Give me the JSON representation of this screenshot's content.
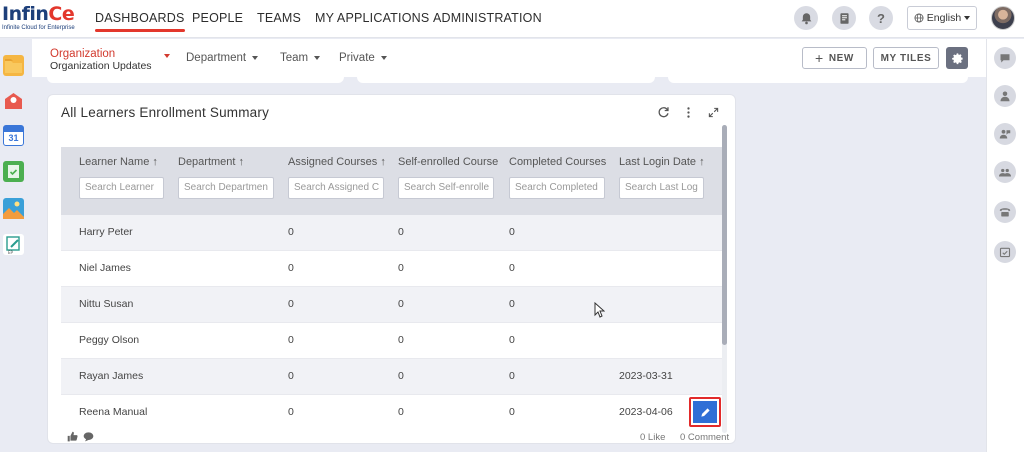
{
  "logo": {
    "name_part1": "Infin",
    "name_part2": "Ce",
    "tagline": "Infinite Cloud for Enterprise"
  },
  "topnav": {
    "items": [
      {
        "label": "DASHBOARDS",
        "active": true
      },
      {
        "label": "PEOPLE",
        "active": false
      },
      {
        "label": "TEAMS",
        "active": false
      },
      {
        "label": "MY APPLICATIONS",
        "active": false
      },
      {
        "label": "ADMINISTRATION",
        "active": false
      }
    ],
    "language": "English",
    "icons": [
      "bell-icon",
      "report-icon",
      "help-icon",
      "globe-icon",
      "avatar"
    ]
  },
  "subnav": {
    "org_label": "Organization",
    "org_value": "Organization Updates",
    "filters": [
      "Department",
      "Team",
      "Private"
    ],
    "new_button": "NEW",
    "tiles_button": "MY TILES"
  },
  "card": {
    "title": "All Learners Enrollment Summary",
    "columns": [
      {
        "label": "Learner Name ↑",
        "placeholder": "Search Learner"
      },
      {
        "label": "Department ↑",
        "placeholder": "Search Departmen"
      },
      {
        "label": "Assigned Courses ↑",
        "placeholder": "Search Assigned C"
      },
      {
        "label": "Self-enrolled Course",
        "placeholder": "Search Self-enrolle"
      },
      {
        "label": "Completed Courses",
        "placeholder": "Search Completed"
      },
      {
        "label": "Last Login Date ↑",
        "placeholder": "Search Last Log"
      }
    ],
    "rows": [
      [
        "Harry Peter",
        "",
        "0",
        "0",
        "0",
        ""
      ],
      [
        "Niel James",
        "",
        "0",
        "0",
        "0",
        ""
      ],
      [
        "Nittu Susan",
        "",
        "0",
        "0",
        "0",
        ""
      ],
      [
        "Peggy Olson",
        "",
        "0",
        "0",
        "0",
        ""
      ],
      [
        "Rayan James",
        "",
        "0",
        "0",
        "0",
        "2023-03-31"
      ],
      [
        "Reena Manual",
        "",
        "0",
        "0",
        "0",
        "2023-04-06"
      ]
    ],
    "likes": "0 Like",
    "comments": "0 Comment"
  },
  "colors": {
    "accent": "#e3372c",
    "primary_button": "#2f6fd6",
    "header_bg": "#dcdee5"
  }
}
